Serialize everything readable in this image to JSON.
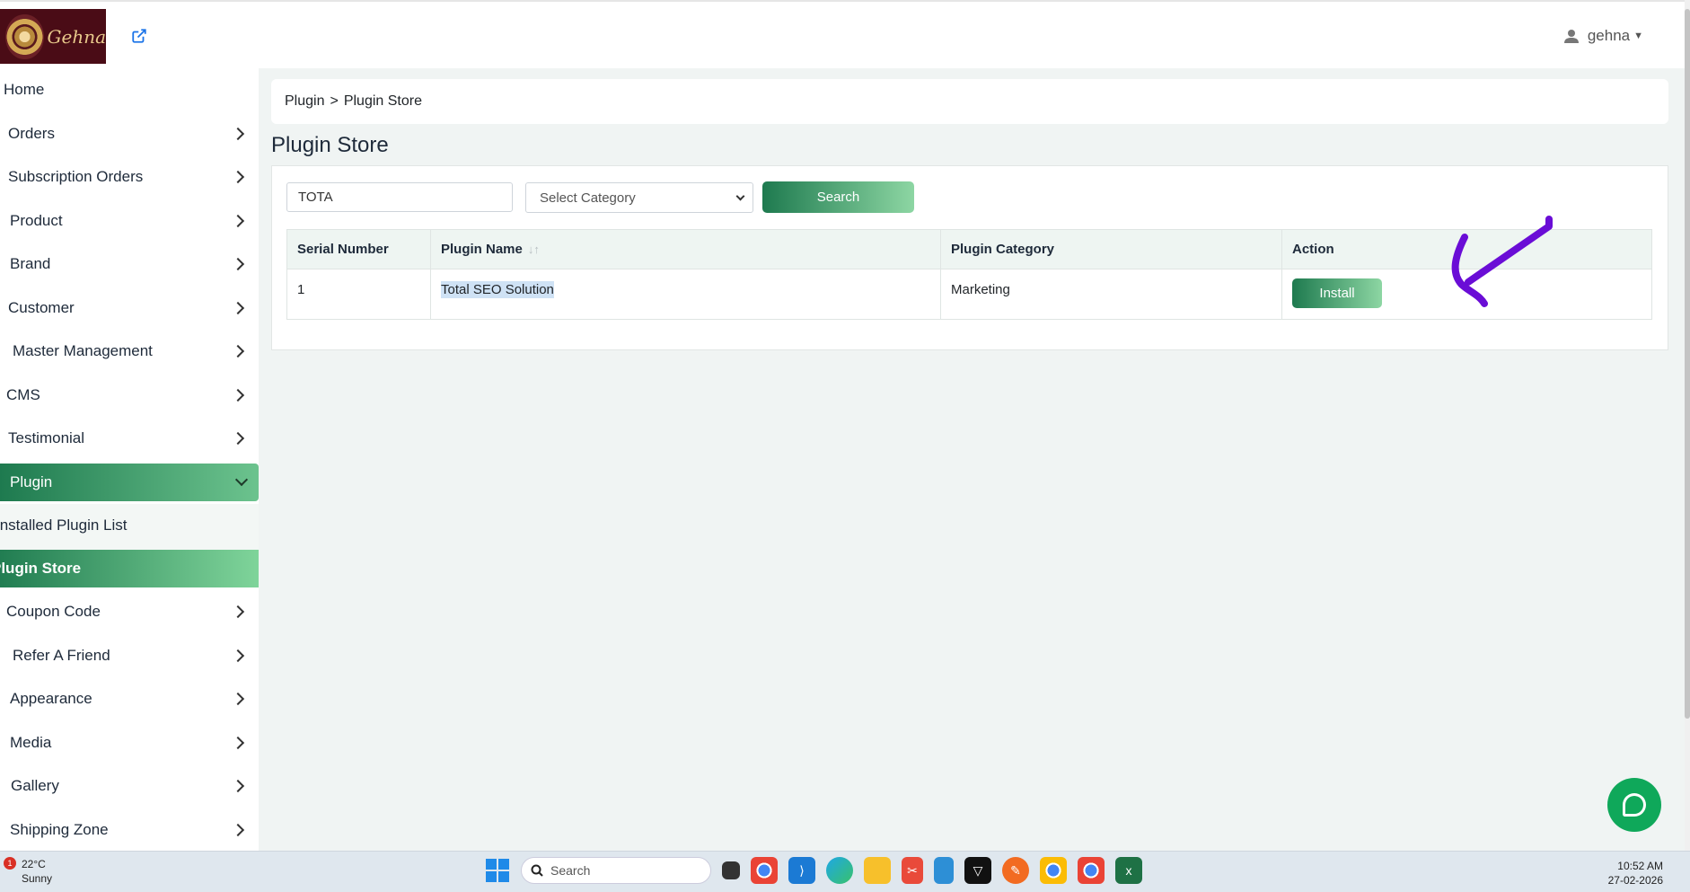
{
  "header": {
    "logo_text": "Gehna",
    "username": "gehna"
  },
  "sidebar": {
    "items": [
      {
        "label": "Home"
      },
      {
        "label": "Orders"
      },
      {
        "label": "Subscription Orders"
      },
      {
        "label": "Product"
      },
      {
        "label": "Brand"
      },
      {
        "label": "Customer"
      },
      {
        "label": "Master Management"
      },
      {
        "label": "CMS"
      },
      {
        "label": "Testimonial"
      },
      {
        "label": "Plugin"
      }
    ],
    "plugin_submenu": [
      {
        "label": "Installed Plugin List"
      },
      {
        "label": "Plugin Store"
      }
    ],
    "items_after": [
      {
        "label": "Coupon Code"
      },
      {
        "label": "Refer A Friend"
      },
      {
        "label": "Appearance"
      },
      {
        "label": "Media"
      },
      {
        "label": "Gallery"
      },
      {
        "label": "Shipping Zone"
      }
    ]
  },
  "breadcrumb": {
    "parent": "Plugin",
    "separator": ">",
    "current": "Plugin Store"
  },
  "page": {
    "title": "Plugin Store"
  },
  "filters": {
    "search_value": "TOTA",
    "category_selected": "Select Category",
    "search_button": "Search"
  },
  "table": {
    "columns": [
      "Serial Number",
      "Plugin Name",
      "Plugin Category",
      "Action"
    ],
    "rows": [
      {
        "serial": "1",
        "name": "Total SEO Solution",
        "category": "Marketing",
        "action": "Install"
      }
    ]
  },
  "taskbar": {
    "weather_badge": "1",
    "temperature": "22°C",
    "condition": "Sunny",
    "search_placeholder": "Search",
    "time": "10:52 AM",
    "date": "27-02-2026"
  },
  "colors": {
    "accent_green_start": "#1e7a4f",
    "accent_green_end": "#8dd6a3",
    "annotation_arrow": "#6a0dd6",
    "logo_bg": "#4a0c16"
  }
}
